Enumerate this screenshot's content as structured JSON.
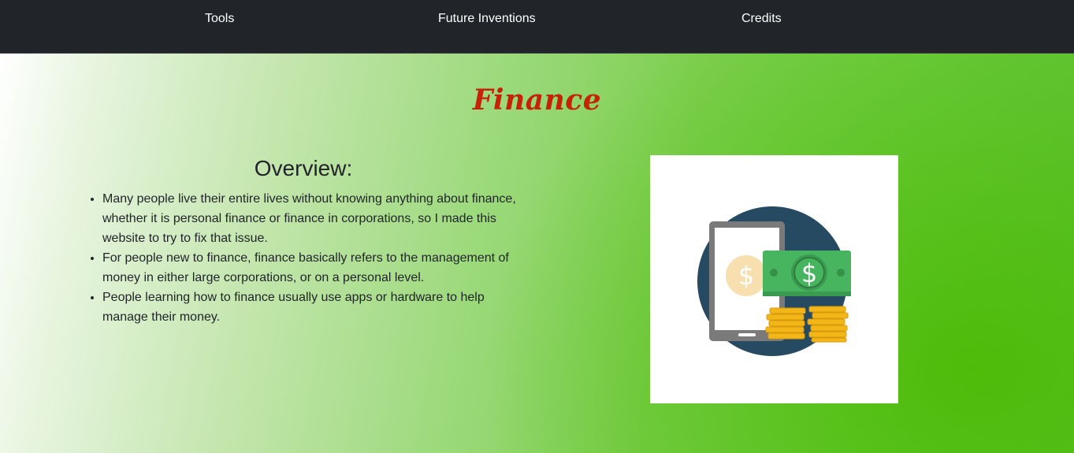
{
  "nav": {
    "items": [
      {
        "label": "Tools"
      },
      {
        "label": "Future Inventions"
      },
      {
        "label": "Credits"
      }
    ]
  },
  "page": {
    "title": "Finance"
  },
  "overview": {
    "heading": "Overview:",
    "bullets": [
      "Many people live their entire lives without knowing anything about finance, whether it is personal finance or finance in corporations, so I made this website to try to fix that issue.",
      "For people new to finance, finance basically refers to the management of money in either large corporations, or on a personal level.",
      "People learning how to finance usually use apps or hardware to help manage their money."
    ]
  },
  "illustration": {
    "icon": "finance-money-phone-icon",
    "symbol": "$"
  },
  "colors": {
    "navbar": "#212529",
    "title": "#c62207",
    "text": "#212529",
    "accent_green": "#5cc23a"
  }
}
